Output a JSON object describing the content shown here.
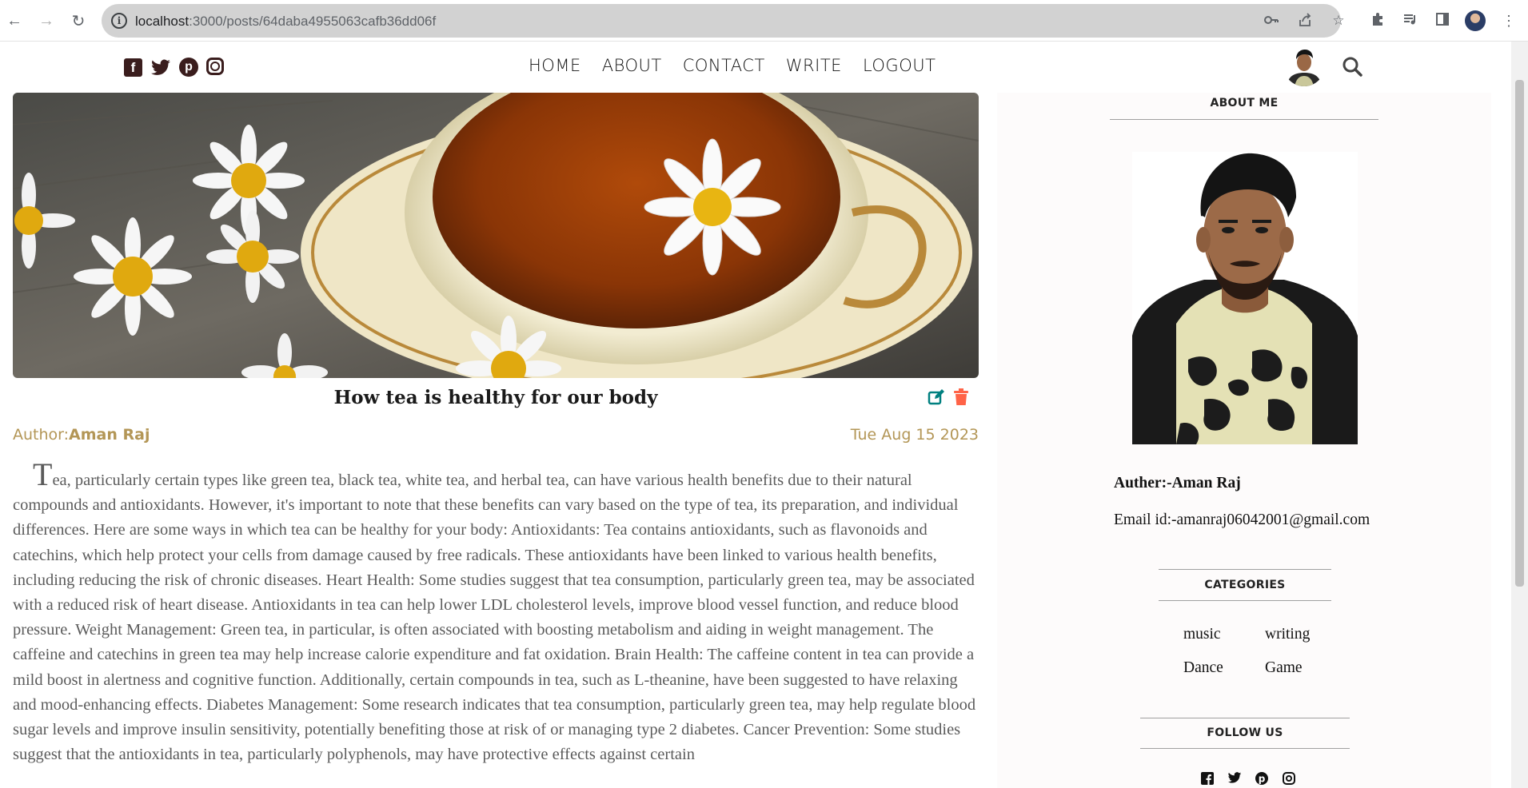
{
  "browser": {
    "url_host": "localhost",
    "url_path": ":3000/posts/64daba4955063cafb36dd06f"
  },
  "header": {
    "menu": [
      "HOME",
      "ABOUT",
      "CONTACT",
      "WRITE",
      "LOGOUT"
    ]
  },
  "post": {
    "title": "How tea is healthy for our body",
    "author_prefix": "Author:",
    "author": "Aman Raj",
    "date": "Tue Aug 15 2023",
    "body": "Tea, particularly certain types like green tea, black tea, white tea, and herbal tea, can have various health benefits due to their natural compounds and antioxidants. However, it's important to note that these benefits can vary based on the type of tea, its preparation, and individual differences. Here are some ways in which tea can be healthy for your body: Antioxidants: Tea contains antioxidants, such as flavonoids and catechins, which help protect your cells from damage caused by free radicals. These antioxidants have been linked to various health benefits, including reducing the risk of chronic diseases. Heart Health: Some studies suggest that tea consumption, particularly green tea, may be associated with a reduced risk of heart disease. Antioxidants in tea can help lower LDL cholesterol levels, improve blood vessel function, and reduce blood pressure. Weight Management: Green tea, in particular, is often associated with boosting metabolism and aiding in weight management. The caffeine and catechins in green tea may help increase calorie expenditure and fat oxidation. Brain Health: The caffeine content in tea can provide a mild boost in alertness and cognitive function. Additionally, certain compounds in tea, such as L-theanine, have been suggested to have relaxing and mood-enhancing effects. Diabetes Management: Some research indicates that tea consumption, particularly green tea, may help regulate blood sugar levels and improve insulin sensitivity, potentially benefiting those at risk of or managing type 2 diabetes. Cancer Prevention: Some studies suggest that the antioxidants in tea, particularly polyphenols, may have protective effects against certain"
  },
  "sidebar": {
    "about_title": "ABOUT ME",
    "author_line": "Auther:-Aman Raj",
    "email_line": "Email id:-amanraj06042001@gmail.com",
    "categories_title": "CATEGORIES",
    "categories": [
      "music",
      "writing",
      "Dance",
      "Game"
    ],
    "follow_title": "FOLLOW US"
  },
  "colors": {
    "meta_gold": "#b39656",
    "edit_icon": "#008080",
    "delete_icon": "#ff6347",
    "social_brown": "#3a1d1d"
  },
  "icons": {
    "browser": [
      "back-icon",
      "forward-icon",
      "reload-icon",
      "info-icon",
      "key-icon",
      "share-icon",
      "star-icon",
      "puzzle-icon",
      "media-icon",
      "sidepanel-icon",
      "kebab-icon"
    ],
    "social": [
      "facebook-icon",
      "twitter-icon",
      "pinterest-icon",
      "instagram-icon"
    ],
    "post": [
      "edit-icon",
      "trash-icon"
    ],
    "header": [
      "search-icon"
    ]
  }
}
